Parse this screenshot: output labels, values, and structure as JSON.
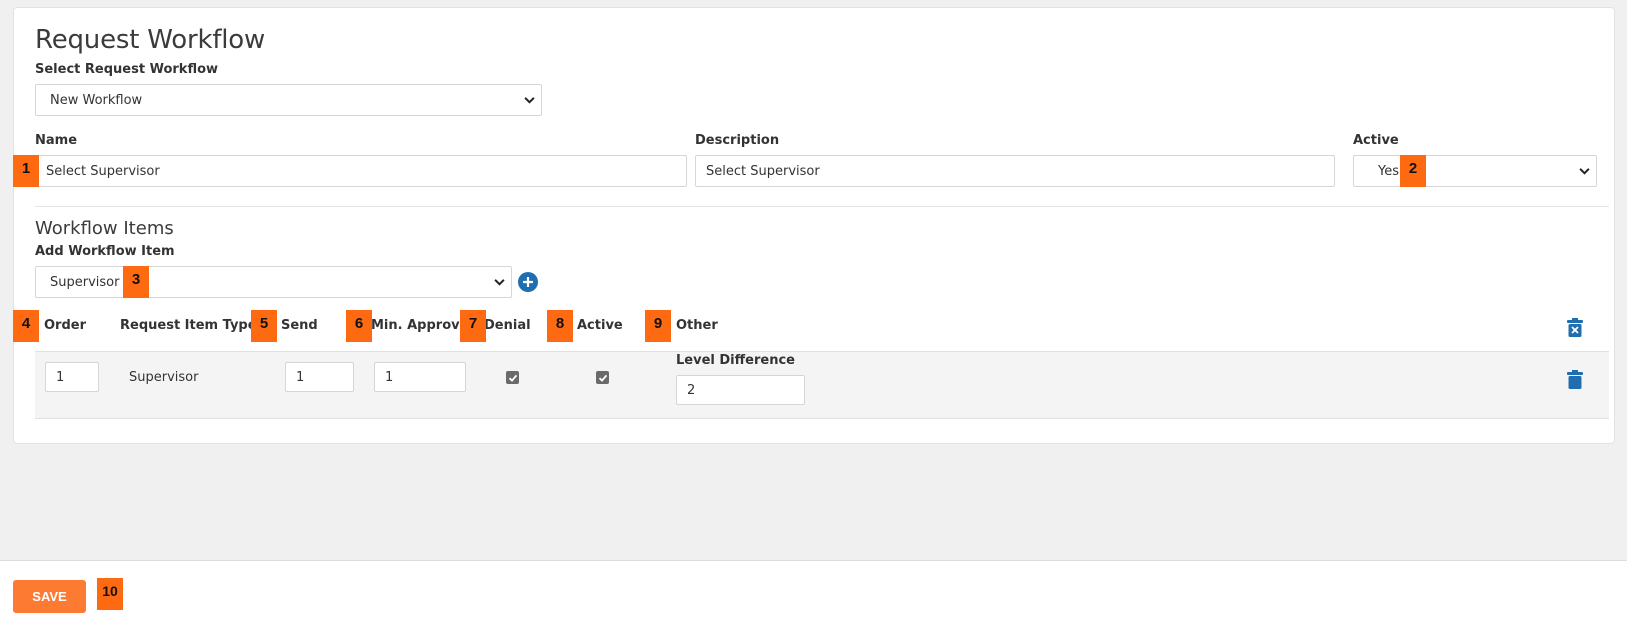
{
  "page": {
    "title": "Request Workflow",
    "select_workflow_label": "Select Request Workflow",
    "select_workflow_value": "New Workflow"
  },
  "form": {
    "name_label": "Name",
    "name_value": "Select Supervisor",
    "description_label": "Description",
    "description_value": "Select Supervisor",
    "active_label": "Active",
    "active_value": "Yes"
  },
  "workflow_items": {
    "section_title": "Workflow Items",
    "add_label": "Add Workflow Item",
    "add_value": "Supervisor",
    "columns": {
      "order": "Order",
      "request_item_type": "Request Item Type",
      "send": "Send",
      "min_approved": "Min. Approved",
      "denial": "Denial",
      "active": "Active",
      "other": "Other"
    },
    "rows": [
      {
        "order": "1",
        "type": "Supervisor",
        "send": "1",
        "min_approved": "1",
        "denial": true,
        "active": true,
        "other_label": "Level Difference",
        "other_value": "2"
      }
    ]
  },
  "badges": [
    "1",
    "2",
    "3",
    "4",
    "5",
    "6",
    "7",
    "8",
    "9",
    "10"
  ],
  "footer": {
    "save_label": "SAVE"
  },
  "colors": {
    "accent": "#fd6a11",
    "save_button": "#fd7a32",
    "icon_blue": "#1f6fb0"
  },
  "icons": {
    "add": "plus-circle-icon",
    "delete_all": "trash-x-icon",
    "delete_row": "trash-icon",
    "dropdown": "chevron-down-icon",
    "check": "checkmark-icon"
  }
}
